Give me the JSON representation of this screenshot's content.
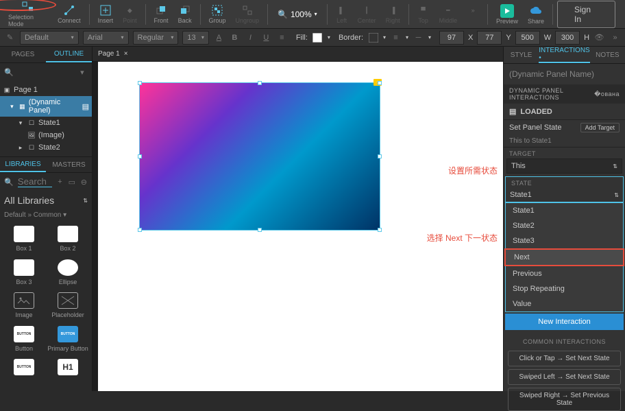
{
  "topbar": {
    "selection_mode": "Selection Mode",
    "connect": "Connect",
    "insert": "Insert",
    "point": "Point",
    "front": "Front",
    "back": "Back",
    "group": "Group",
    "ungroup": "Ungroup",
    "zoom": "100%",
    "left": "Left",
    "center": "Center",
    "right": "Right",
    "top": "Top",
    "middle": "Middle",
    "preview": "Preview",
    "share": "Share",
    "signin": "Sign In"
  },
  "toolbar2": {
    "style": "Default",
    "font": "Arial",
    "weight": "Regular",
    "size": "13",
    "fill": "Fill:",
    "border": "Border:",
    "x_lbl": "X",
    "x": "97",
    "y_lbl": "Y",
    "y": "77",
    "w_lbl": "W",
    "w": "500",
    "h_lbl": "H",
    "h": "300"
  },
  "left": {
    "tab_pages": "PAGES",
    "tab_outline": "OUTLINE",
    "tree": {
      "page": "Page 1",
      "dp": "(Dynamic Panel)",
      "state1": "State1",
      "image": "(Image)",
      "state2": "State2"
    },
    "tab_libraries": "LIBRARIES",
    "tab_masters": "MASTERS",
    "search": "Search",
    "all_libs": "All Libraries",
    "subset": "Default » Common ▾",
    "widgets": {
      "box1": "Box 1",
      "box2": "Box 2",
      "box3": "Box 3",
      "ellipse": "Ellipse",
      "image": "Image",
      "placeholder": "Placeholder",
      "button": "Button",
      "primary_button": "Primary Button",
      "h1_glyph": "H1",
      "btn_glyph": "BUTTON"
    }
  },
  "canvas": {
    "page_tab": "Page 1"
  },
  "annotations": {
    "set_state": "设置所需状态",
    "choose_next": "选择 Next 下一状态"
  },
  "right": {
    "tab_style": "STYLE",
    "tab_interactions": "INTERACTIONS •",
    "tab_notes": "NOTES",
    "dp_name": "(Dynamic Panel Name)",
    "section": "DYNAMIC PANEL INTERACTIONS",
    "loaded": "LOADED",
    "action": "Set Panel State",
    "add_target": "Add Target",
    "desc": "This to State1",
    "target_lbl": "TARGET",
    "target_val": "This",
    "state_lbl": "STATE",
    "state_val": "State1",
    "dd": {
      "s1": "State1",
      "s2": "State2",
      "s3": "State3",
      "next": "Next",
      "prev": "Previous",
      "stop": "Stop Repeating",
      "value": "Value"
    },
    "new_interaction": "New Interaction",
    "common_hdr": "COMMON INTERACTIONS",
    "common1": "Click or Tap → Set Next State",
    "common2": "Swiped Left → Set Next State",
    "common3": "Swiped Right → Set Previous State"
  }
}
